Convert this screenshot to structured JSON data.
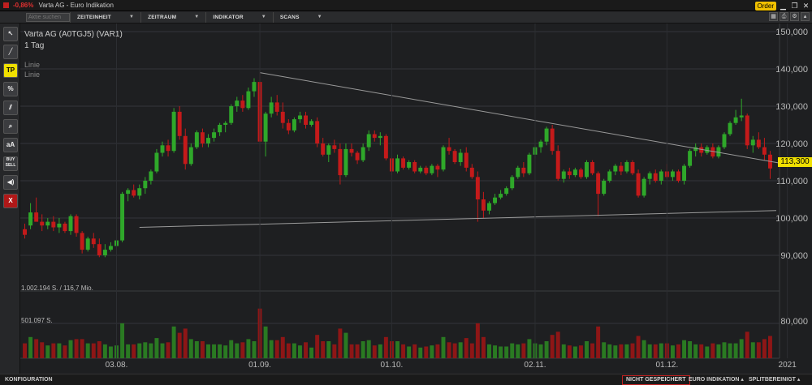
{
  "window": {
    "change": "-0,86%",
    "title": "Varta AG - Euro Indikation",
    "order_label": "Order"
  },
  "toolbar": {
    "search_placeholder": "Aktie suchen",
    "menus": [
      "ZEITEINHEIT",
      "ZEITRAUM",
      "INDIKATOR",
      "SCANS"
    ]
  },
  "sidebar": {
    "tp_label": "TP",
    "percent_label": "%",
    "text_label": "aA",
    "buysell_label": "BUY SELL",
    "close_label": "X"
  },
  "chart_header": {
    "instrument": "Varta AG (A0TGJ5) (VAR1)",
    "timeframe": "1 Tag",
    "overlay_1": "Linie",
    "overlay_2": "Linie"
  },
  "volume_labels": {
    "upper": "1.002.194 S. / 116,7 Mio.",
    "lower": "501.097 S."
  },
  "last_price": "113,300",
  "statusbar": {
    "config": "KONFIGURATION",
    "not_saved": "NICHT GESPEICHERT",
    "indication": "EURO INDIKATION ▴",
    "split": "SPLITBEREINIGT ▴"
  },
  "colors": {
    "up": "#2fa82a",
    "down": "#c41a1a",
    "accent": "#f0e000",
    "background": "#1e1f21"
  },
  "chart_data": {
    "type": "candlestick",
    "title": "Varta AG (A0TGJ5) (VAR1)",
    "ylim": [
      85000,
      152000
    ],
    "y_ticks": [
      "150,000",
      "140,000",
      "130,000",
      "120,000",
      "110,000",
      "100,000",
      "90,000",
      "80,000"
    ],
    "x_ticks": [
      "03.08.",
      "01.09.",
      "01.10.",
      "02.11.",
      "01.12.",
      "2021"
    ],
    "ohlc": [
      [
        97000,
        98500,
        94500,
        95500
      ],
      [
        98000,
        104000,
        97000,
        101500
      ],
      [
        101500,
        105500,
        99500,
        99000
      ],
      [
        99000,
        101000,
        96500,
        98000
      ],
      [
        98000,
        100000,
        97000,
        99000
      ],
      [
        99000,
        100500,
        96500,
        97500
      ],
      [
        97500,
        100000,
        96000,
        98500
      ],
      [
        98500,
        99000,
        96000,
        96500
      ],
      [
        96500,
        101000,
        95500,
        100500
      ],
      [
        100500,
        101000,
        95000,
        96000
      ],
      [
        96000,
        96500,
        90500,
        91500
      ],
      [
        91500,
        95000,
        91000,
        94500
      ],
      [
        94500,
        96000,
        92000,
        93000
      ],
      [
        93000,
        94500,
        89500,
        90000
      ],
      [
        90000,
        93000,
        89500,
        91500
      ],
      [
        91500,
        93500,
        91000,
        92500
      ],
      [
        92500,
        94500,
        91500,
        94000
      ],
      [
        94000,
        107000,
        93500,
        106500
      ],
      [
        106500,
        108000,
        104500,
        107500
      ],
      [
        107500,
        109000,
        105500,
        106000
      ],
      [
        106000,
        109000,
        105000,
        108000
      ],
      [
        108000,
        111000,
        106500,
        110000
      ],
      [
        110000,
        113000,
        109000,
        112500
      ],
      [
        112500,
        118500,
        112000,
        117500
      ],
      [
        117500,
        120500,
        116500,
        119500
      ],
      [
        119500,
        121000,
        116500,
        118000
      ],
      [
        118000,
        129500,
        117500,
        128500
      ],
      [
        128500,
        130000,
        121000,
        122000
      ],
      [
        122000,
        124000,
        113000,
        114500
      ],
      [
        114500,
        120000,
        114000,
        119000
      ],
      [
        119000,
        123500,
        118500,
        123000
      ],
      [
        123000,
        124000,
        119000,
        120000
      ],
      [
        120000,
        122500,
        119000,
        121500
      ],
      [
        121500,
        124000,
        120500,
        123000
      ],
      [
        123000,
        125500,
        122000,
        125000
      ],
      [
        125000,
        126000,
        123000,
        125500
      ],
      [
        125500,
        130500,
        125000,
        130000
      ],
      [
        130000,
        132500,
        128500,
        131500
      ],
      [
        131500,
        133000,
        128500,
        129500
      ],
      [
        129500,
        135000,
        129000,
        134000
      ],
      [
        134000,
        137500,
        132500,
        136500
      ],
      [
        136500,
        139000,
        118500,
        120500
      ],
      [
        120500,
        128500,
        116500,
        128000
      ],
      [
        128000,
        132500,
        127000,
        131000
      ],
      [
        131000,
        133000,
        127500,
        128500
      ],
      [
        128500,
        131000,
        124000,
        125500
      ],
      [
        125500,
        126500,
        122500,
        123500
      ],
      [
        123500,
        127000,
        123000,
        126500
      ],
      [
        126500,
        128500,
        125500,
        127500
      ],
      [
        127500,
        128500,
        124000,
        125000
      ],
      [
        125000,
        126500,
        124500,
        126000
      ],
      [
        126000,
        127000,
        119000,
        120000
      ],
      [
        120000,
        121500,
        116500,
        117000
      ],
      [
        117000,
        120000,
        115000,
        119500
      ],
      [
        119500,
        121000,
        117500,
        118500
      ],
      [
        118500,
        120000,
        109000,
        111500
      ],
      [
        111500,
        120000,
        111000,
        118500
      ],
      [
        118500,
        120000,
        116500,
        117500
      ],
      [
        117500,
        118000,
        114500,
        115500
      ],
      [
        115500,
        120000,
        115000,
        119000
      ],
      [
        119000,
        123500,
        118000,
        122500
      ],
      [
        122500,
        123500,
        120500,
        121500
      ],
      [
        121500,
        123000,
        119500,
        122000
      ],
      [
        122000,
        122500,
        115500,
        116000
      ],
      [
        116000,
        116500,
        111500,
        112500
      ],
      [
        112500,
        117000,
        112000,
        116000
      ],
      [
        116000,
        116500,
        113000,
        113500
      ],
      [
        113500,
        115500,
        113000,
        115000
      ],
      [
        115000,
        115500,
        112000,
        112500
      ],
      [
        112500,
        114000,
        112000,
        113500
      ],
      [
        113500,
        114000,
        111500,
        112000
      ],
      [
        112000,
        114500,
        111500,
        114000
      ],
      [
        114000,
        114500,
        111000,
        113000
      ],
      [
        113000,
        119500,
        112500,
        119000
      ],
      [
        119000,
        121500,
        117000,
        118000
      ],
      [
        118000,
        118500,
        114500,
        115000
      ],
      [
        115000,
        118500,
        114000,
        117500
      ],
      [
        117500,
        119000,
        112500,
        113500
      ],
      [
        113500,
        114500,
        110500,
        111000
      ],
      [
        111000,
        112500,
        99000,
        105000
      ],
      [
        105000,
        107000,
        100000,
        102000
      ],
      [
        102000,
        104500,
        101000,
        104000
      ],
      [
        104000,
        106500,
        103500,
        105500
      ],
      [
        105500,
        107500,
        105000,
        106500
      ],
      [
        106500,
        108500,
        106000,
        108000
      ],
      [
        108000,
        111500,
        107500,
        111000
      ],
      [
        111000,
        114000,
        110500,
        113500
      ],
      [
        113500,
        115000,
        111000,
        112000
      ],
      [
        112000,
        117500,
        111500,
        117000
      ],
      [
        117000,
        120000,
        116000,
        119000
      ],
      [
        119000,
        121000,
        117500,
        120500
      ],
      [
        120500,
        124500,
        119500,
        124000
      ],
      [
        124000,
        125000,
        117000,
        118000
      ],
      [
        118000,
        119500,
        110000,
        110500
      ],
      [
        110500,
        113000,
        109500,
        112500
      ],
      [
        112500,
        113500,
        110500,
        111500
      ],
      [
        111500,
        113500,
        111000,
        113000
      ],
      [
        113000,
        113500,
        110500,
        111000
      ],
      [
        111000,
        115500,
        110500,
        115000
      ],
      [
        115000,
        115500,
        111500,
        112000
      ],
      [
        112000,
        112500,
        100500,
        106500
      ],
      [
        106500,
        110500,
        106000,
        110000
      ],
      [
        110000,
        113000,
        109500,
        112500
      ],
      [
        112500,
        114500,
        111500,
        114000
      ],
      [
        114000,
        115000,
        111500,
        112500
      ],
      [
        112500,
        115500,
        112000,
        115000
      ],
      [
        115000,
        115500,
        111500,
        112000
      ],
      [
        112000,
        113000,
        105500,
        106000
      ],
      [
        106000,
        111000,
        105500,
        110500
      ],
      [
        110500,
        112500,
        109000,
        112000
      ],
      [
        112000,
        113000,
        109500,
        110000
      ],
      [
        110000,
        113000,
        109000,
        112500
      ],
      [
        112500,
        114500,
        110500,
        111000
      ],
      [
        111000,
        113000,
        110000,
        112500
      ],
      [
        112500,
        113000,
        109500,
        110000
      ],
      [
        110000,
        114500,
        109000,
        114000
      ],
      [
        114000,
        118500,
        113500,
        118000
      ],
      [
        118000,
        120000,
        116500,
        119000
      ],
      [
        119000,
        120000,
        116500,
        117500
      ],
      [
        117500,
        119500,
        117000,
        119000
      ],
      [
        119000,
        120000,
        116000,
        116500
      ],
      [
        116500,
        119500,
        116000,
        119000
      ],
      [
        119000,
        123000,
        118500,
        122500
      ],
      [
        122500,
        126000,
        122000,
        125500
      ],
      [
        125500,
        129000,
        125000,
        127000
      ],
      [
        127000,
        132000,
        126000,
        127500
      ],
      [
        127500,
        128000,
        118500,
        119500
      ],
      [
        119500,
        122000,
        117500,
        121000
      ],
      [
        121000,
        123000,
        118500,
        119000
      ],
      [
        119000,
        121500,
        115500,
        117000
      ],
      [
        117000,
        118000,
        110500,
        113300
      ]
    ],
    "volume_ticks": [
      "1.002.194 S. / 116,7 Mio.",
      "501.097 S."
    ],
    "trendlines": [
      {
        "from": [
          "01.09.",
          139000
        ],
        "to": [
          "2021",
          114000
        ]
      },
      {
        "from": [
          "03.08.",
          97500
        ],
        "to": [
          "2021",
          102000
        ]
      }
    ]
  }
}
